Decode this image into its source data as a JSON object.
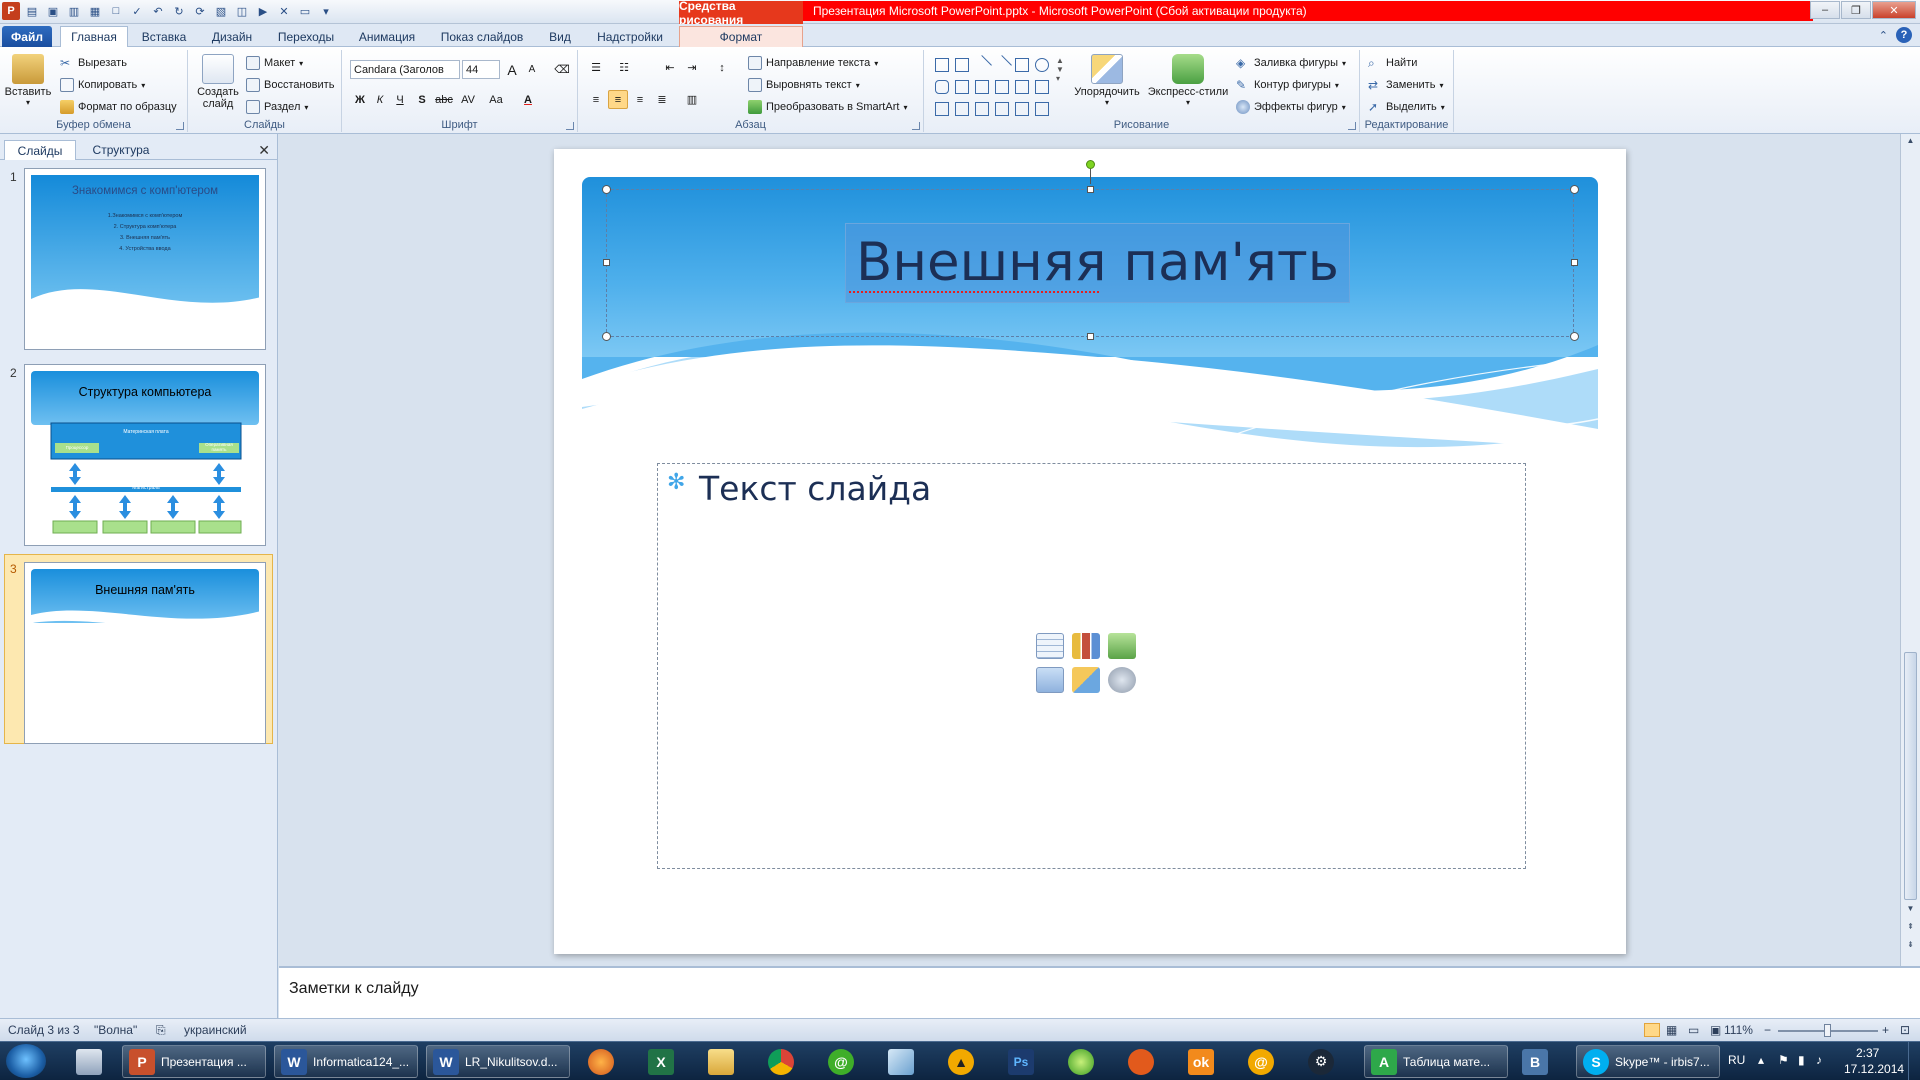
{
  "titlebar": {
    "context_tab": "Средства рисования",
    "window_title": "Презентация Microsoft PowerPoint.pptx  -  Microsoft PowerPoint (Сбой активации продукта)"
  },
  "tabs": {
    "file": "Файл",
    "home": "Главная",
    "insert": "Вставка",
    "design": "Дизайн",
    "transitions": "Переходы",
    "animation": "Анимация",
    "slideshow": "Показ слайдов",
    "view": "Вид",
    "addins": "Надстройки",
    "format": "Формат"
  },
  "ribbon": {
    "clipboard": {
      "label": "Буфер обмена",
      "paste": "Вставить",
      "cut": "Вырезать",
      "copy": "Копировать",
      "format_painter": "Формат по образцу"
    },
    "slides": {
      "label": "Слайды",
      "new_slide_line1": "Создать",
      "new_slide_line2": "слайд",
      "layout": "Макет",
      "reset": "Восстановить",
      "section": "Раздел"
    },
    "font": {
      "label": "Шрифт",
      "font_name": "Candara (Заголов",
      "font_size": "44",
      "bold": "Ж",
      "italic": "К",
      "underline": "Ч",
      "shadow": "S",
      "strike": "abc",
      "spacing": "AV",
      "case": "Aa",
      "color": "A",
      "grow": "A",
      "shrink": "A"
    },
    "paragraph": {
      "label": "Абзац",
      "text_direction": "Направление текста",
      "align_text": "Выровнять текст",
      "smartart": "Преобразовать в SmartArt"
    },
    "drawing": {
      "label": "Рисование",
      "arrange": "Упорядочить",
      "quick_styles": "Экспресс-стили",
      "fill": "Заливка фигуры",
      "outline": "Контур фигуры",
      "effects": "Эффекты фигур"
    },
    "editing": {
      "label": "Редактирование",
      "find": "Найти",
      "replace": "Заменить",
      "select": "Выделить"
    }
  },
  "left_panel": {
    "tab_slides": "Слайды",
    "tab_outline": "Структура",
    "thumbnails": [
      {
        "num": "1",
        "title": "Знакомимся с комп'ютером",
        "lines": [
          "1.Знакомимся с комп'ютером",
          "2. Структура комп'ютера",
          "3. Внешняя пам'ять",
          "4. Устройства ввода"
        ]
      },
      {
        "num": "2",
        "title": "Структура компьютера",
        "board": "Материнская плата",
        "bus": "Магистраль",
        "proc": "Процессор",
        "ram": "Оперативная память"
      },
      {
        "num": "3",
        "title": "Внешняя пам'ять"
      }
    ]
  },
  "slide": {
    "title": "Внешняя пам'ять",
    "body_text": "Текст слайда"
  },
  "notes": {
    "placeholder": "Заметки к слайду"
  },
  "status": {
    "slide_counter": "Слайд 3 из 3",
    "theme": "\"Волна\"",
    "language": "украинский",
    "zoom": "111%"
  },
  "taskbar": {
    "items": [
      {
        "label": "Презентация ...",
        "color": "#c8502c",
        "letter": "P"
      },
      {
        "label": "Informatica124_...",
        "color": "#2b579a",
        "letter": "W"
      },
      {
        "label": "LR_Nikulitsov.d...",
        "color": "#2b579a",
        "letter": "W"
      }
    ],
    "table_item": "Таблица мате...",
    "skype_item": "Skype™ - irbis7...",
    "lang": "RU",
    "time": "2:37",
    "date": "17.12.2014"
  },
  "colors": {
    "accent_blue": "#1f90db",
    "title_text": "#1c2f55",
    "context_red": "#e6381c"
  }
}
